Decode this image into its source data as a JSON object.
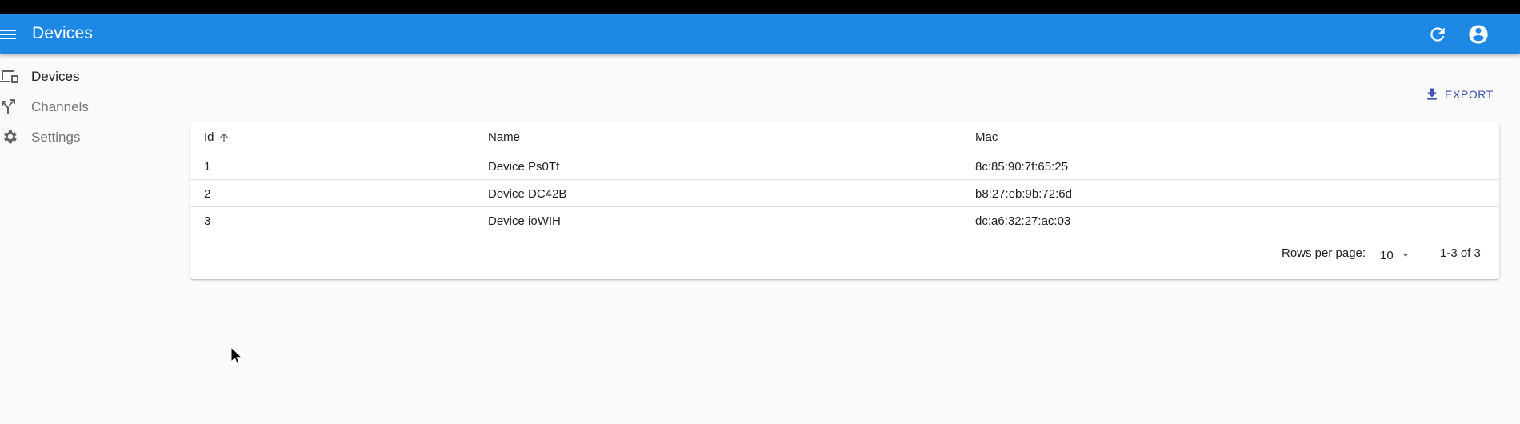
{
  "app": {
    "title": "Devices",
    "bar_color": "#1e88e5"
  },
  "icons": {
    "menu": "menu-icon",
    "refresh": "refresh-icon",
    "account": "account-circle-icon",
    "export": "download-icon",
    "sort": "arrow-up-icon",
    "dropdown": "chevron-down-icon"
  },
  "sidebar": {
    "items": [
      {
        "label": "Devices",
        "icon": "devices-icon",
        "active": true
      },
      {
        "label": "Channels",
        "icon": "fork-icon",
        "active": false
      },
      {
        "label": "Settings",
        "icon": "gear-icon",
        "active": false
      }
    ]
  },
  "toolbar": {
    "export_label": "EXPORT"
  },
  "table": {
    "columns": [
      "Id",
      "Name",
      "Mac"
    ],
    "sort_column": "Id",
    "sort_direction": "asc",
    "rows": [
      {
        "id": "1",
        "name": "Device Ps0Tf",
        "mac": "8c:85:90:7f:65:25"
      },
      {
        "id": "2",
        "name": "Device DC42B",
        "mac": "b8:27:eb:9b:72:6d"
      },
      {
        "id": "3",
        "name": "Device ioWIH",
        "mac": "dc:a6:32:27:ac:03"
      }
    ],
    "pagination": {
      "rows_per_page_label": "Rows per page:",
      "rows_per_page": "10",
      "range": "1-3 of 3"
    }
  }
}
